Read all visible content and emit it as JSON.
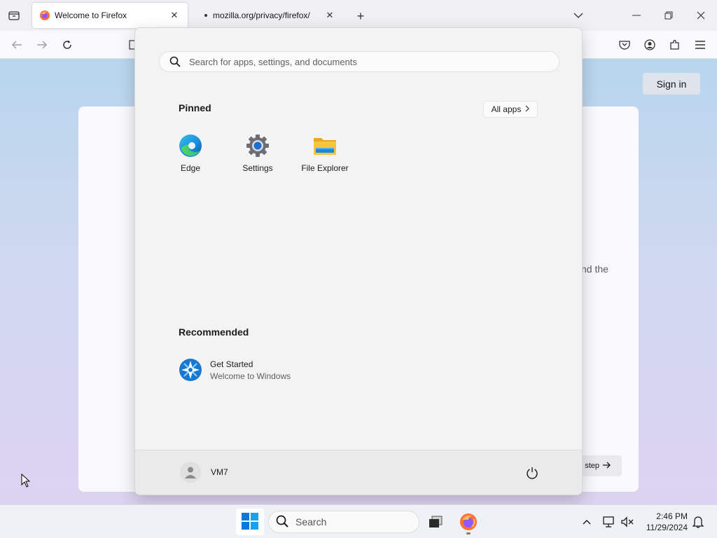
{
  "browser": {
    "tabs": [
      {
        "title": "Welcome to Firefox",
        "active": true
      },
      {
        "title": "mozilla.org/privacy/firefox/",
        "active": false
      }
    ]
  },
  "page": {
    "sign_in_label": "Sign in",
    "card_partial_text": "nd the",
    "card_button_label": "step"
  },
  "start_menu": {
    "search_placeholder": "Search for apps, settings, and documents",
    "pinned_title": "Pinned",
    "all_apps_label": "All apps",
    "pinned_apps": [
      {
        "label": "Edge",
        "icon": "edge-icon"
      },
      {
        "label": "Settings",
        "icon": "settings-gear-icon"
      },
      {
        "label": "File Explorer",
        "icon": "folder-icon"
      }
    ],
    "recommended_title": "Recommended",
    "recommended": [
      {
        "title": "Get Started",
        "subtitle": "Welcome to Windows",
        "icon": "get-started-icon"
      }
    ],
    "user_name": "VM7"
  },
  "taskbar": {
    "search_label": "Search",
    "time": "2:46 PM",
    "date": "11/29/2024"
  },
  "colors": {
    "windows_blue": "#0078d4",
    "firefox_orange": "#ff7139",
    "folder_yellow": "#f8c63d"
  }
}
